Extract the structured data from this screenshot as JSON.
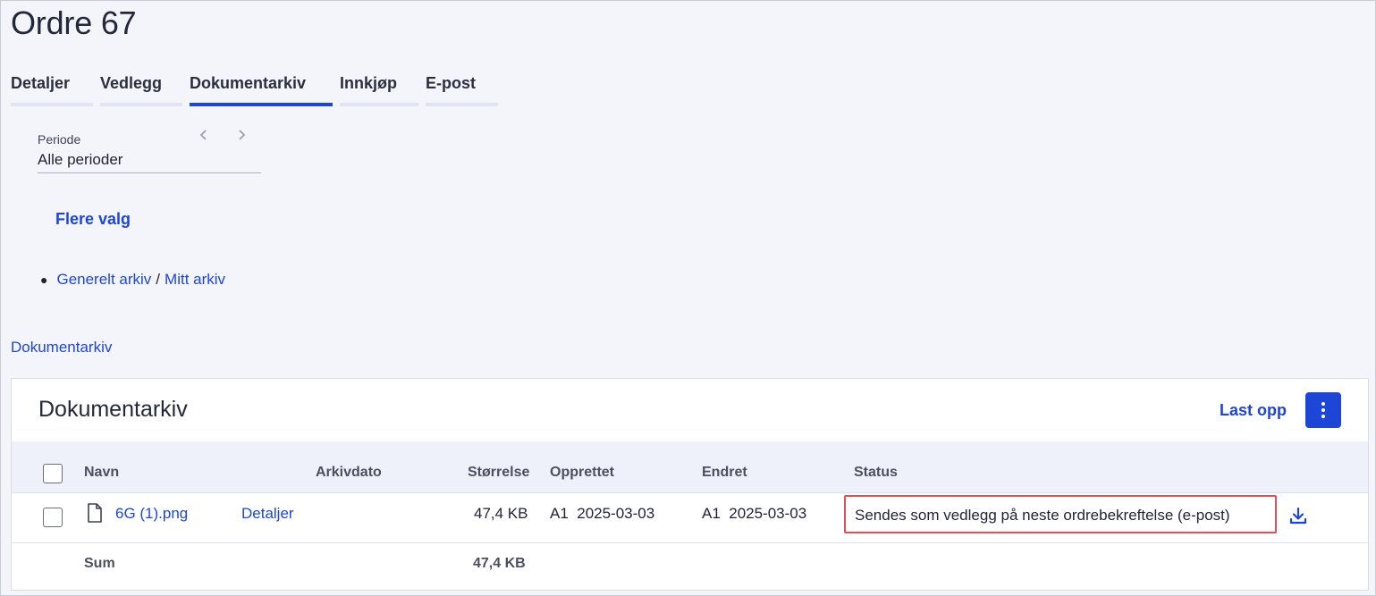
{
  "page": {
    "title": "Ordre 67"
  },
  "tabs": [
    {
      "label": "Detaljer"
    },
    {
      "label": "Vedlegg"
    },
    {
      "label": "Dokumentarkiv",
      "active": true
    },
    {
      "label": "Innkjøp"
    },
    {
      "label": "E-post"
    }
  ],
  "period": {
    "label": "Periode",
    "value": "Alle perioder"
  },
  "more_options": "Flere valg",
  "archive_path": {
    "general": "Generelt arkiv",
    "separator": "/",
    "mine": "Mitt arkiv"
  },
  "breadcrumb": "Dokumentarkiv",
  "panel": {
    "title": "Dokumentarkiv",
    "upload_label": "Last opp",
    "columns": {
      "name": "Navn",
      "archive_date": "Arkivdato",
      "size": "Størrelse",
      "created": "Opprettet",
      "modified": "Endret",
      "status": "Status"
    },
    "rows": [
      {
        "name": "6G (1).png",
        "details": "Detaljer",
        "archive_date": "",
        "size": "47,4 KB",
        "created": "A1  2025-03-03",
        "modified": "A1  2025-03-03",
        "status": "Sendes som vedlegg på neste ordrebekreftelse (e-post)"
      }
    ],
    "sum": {
      "label": "Sum",
      "size": "47,4 KB"
    }
  },
  "colors": {
    "accent": "#1d46d6",
    "highlight": "#dd4f5a",
    "background": "#f4f5fb"
  },
  "icons": [
    "chevron-left-icon",
    "chevron-right-icon",
    "kebab-menu-icon",
    "file-icon",
    "download-icon"
  ]
}
